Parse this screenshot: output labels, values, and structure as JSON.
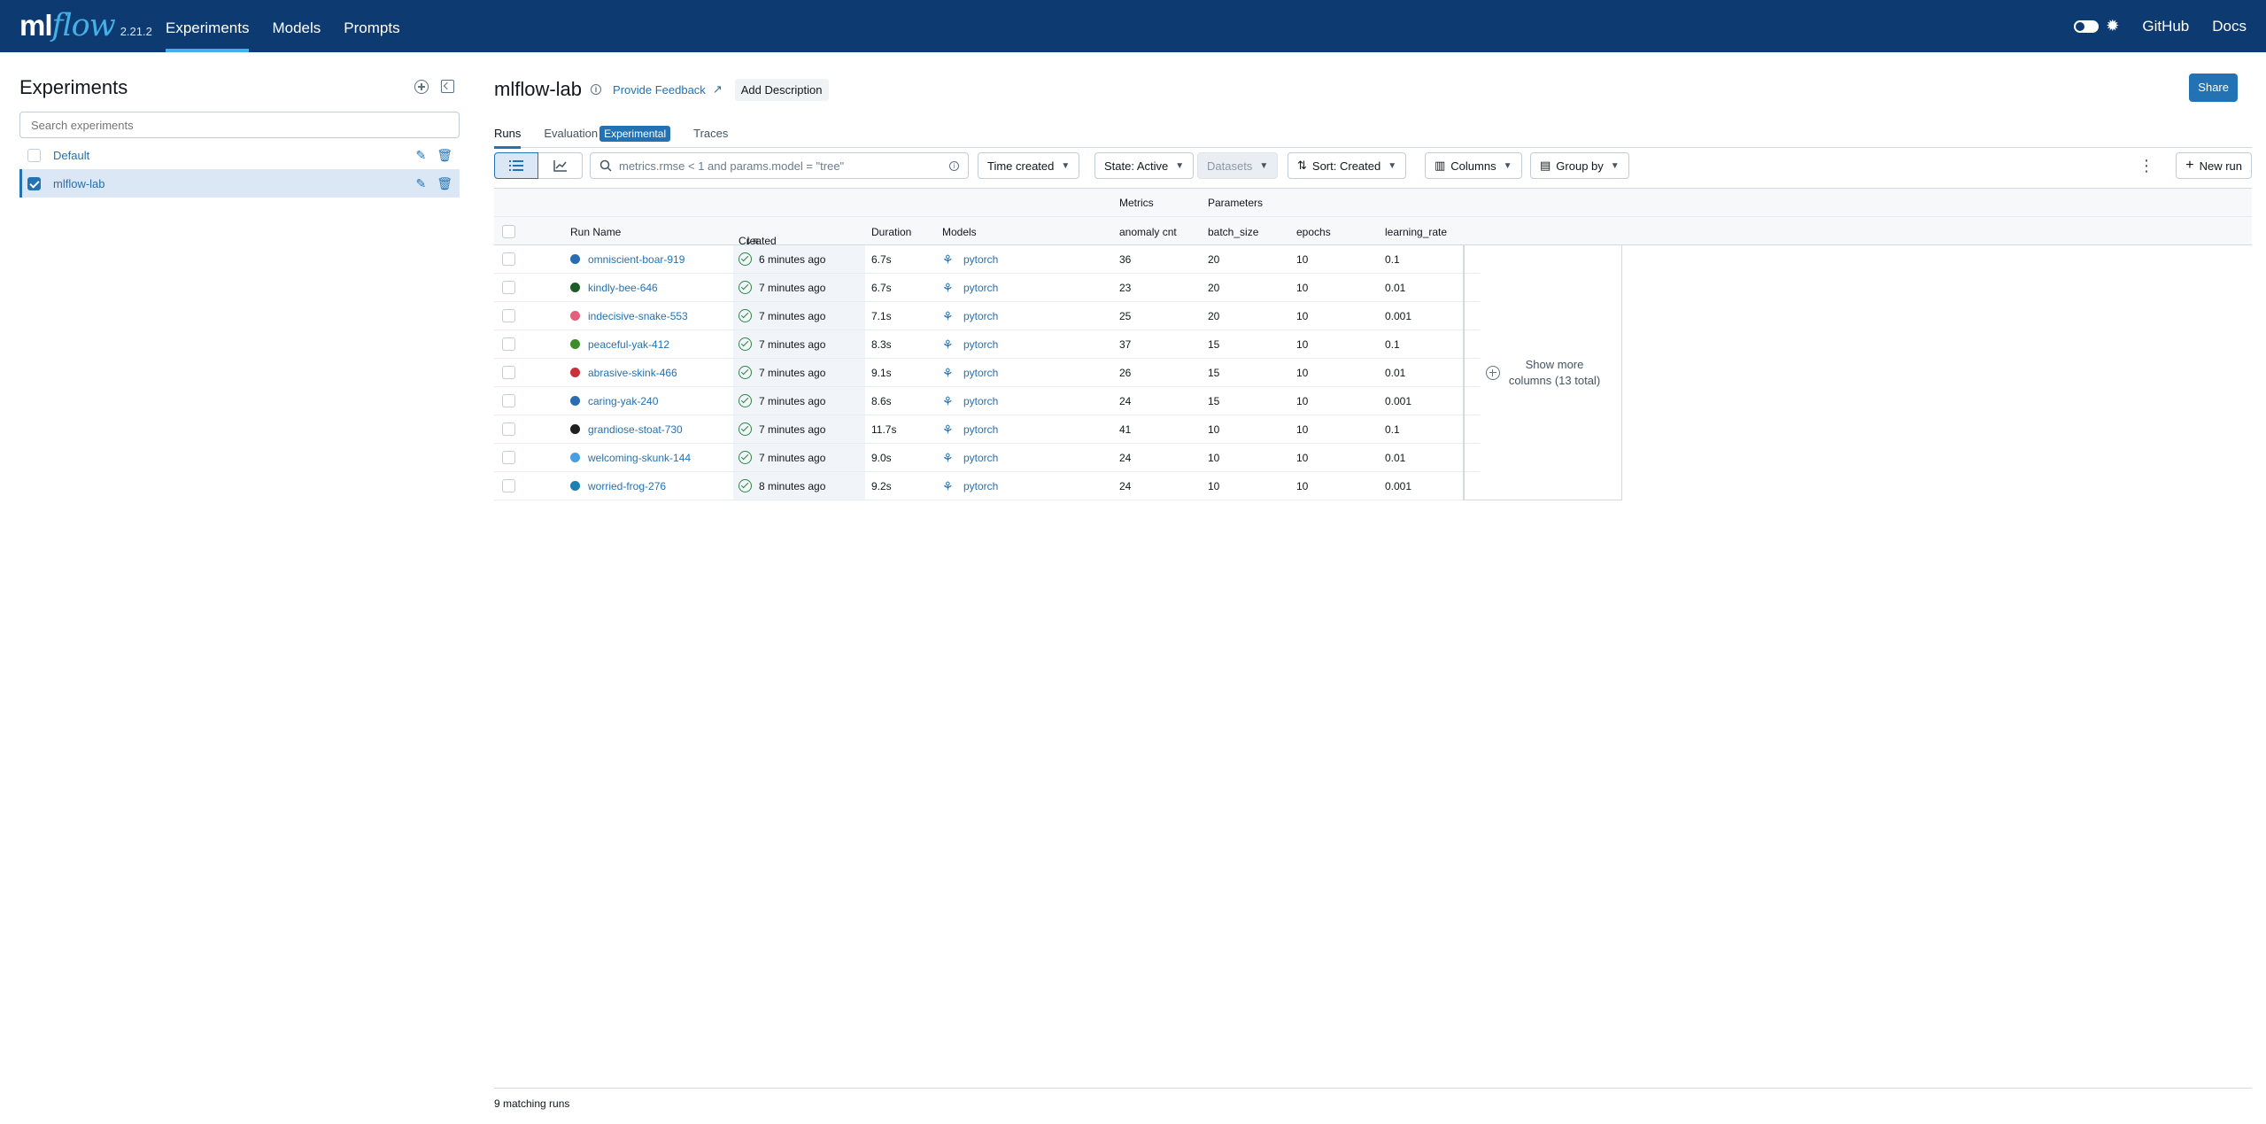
{
  "header": {
    "logo_ml": "ml",
    "logo_flow": "flow",
    "version": "2.21.2",
    "nav": [
      "Experiments",
      "Models",
      "Prompts"
    ],
    "github": "GitHub",
    "docs": "Docs"
  },
  "sidebar": {
    "title": "Experiments",
    "search_placeholder": "Search experiments",
    "items": [
      {
        "name": "Default",
        "checked": false
      },
      {
        "name": "mlflow-lab",
        "checked": true
      }
    ]
  },
  "main": {
    "title": "mlflow-lab",
    "feedback": "Provide Feedback",
    "add_description": "Add Description",
    "share": "Share",
    "tabs": {
      "runs": "Runs",
      "evaluation": "Evaluation",
      "experimental": "Experimental",
      "traces": "Traces"
    },
    "toolbar": {
      "search_placeholder": "metrics.rmse < 1 and params.model = \"tree\"",
      "time_created": "Time created",
      "state": "State: Active",
      "datasets": "Datasets",
      "sort": "Sort: Created",
      "columns": "Columns",
      "group_by": "Group by",
      "new_run": "New run"
    },
    "table": {
      "group_metrics": "Metrics",
      "group_params": "Parameters",
      "headers": {
        "run_name": "Run Name",
        "created": "Created",
        "duration": "Duration",
        "models": "Models",
        "anomaly": "anomaly cnt",
        "batch": "batch_size",
        "epochs": "epochs",
        "lr": "learning_rate"
      },
      "rows": [
        {
          "name": "omniscient-boar-919",
          "color": "#2a6cb0",
          "created": "6 minutes ago",
          "duration": "6.7s",
          "model": "pytorch",
          "anomaly": "36",
          "batch": "20",
          "epochs": "10",
          "lr": "0.1"
        },
        {
          "name": "kindly-bee-646",
          "color": "#1d5c2a",
          "created": "7 minutes ago",
          "duration": "6.7s",
          "model": "pytorch",
          "anomaly": "23",
          "batch": "20",
          "epochs": "10",
          "lr": "0.01"
        },
        {
          "name": "indecisive-snake-553",
          "color": "#e0607e",
          "created": "7 minutes ago",
          "duration": "7.1s",
          "model": "pytorch",
          "anomaly": "25",
          "batch": "20",
          "epochs": "10",
          "lr": "0.001"
        },
        {
          "name": "peaceful-yak-412",
          "color": "#3d8c2a",
          "created": "7 minutes ago",
          "duration": "8.3s",
          "model": "pytorch",
          "anomaly": "37",
          "batch": "15",
          "epochs": "10",
          "lr": "0.1"
        },
        {
          "name": "abrasive-skink-466",
          "color": "#c8303c",
          "created": "7 minutes ago",
          "duration": "9.1s",
          "model": "pytorch",
          "anomaly": "26",
          "batch": "15",
          "epochs": "10",
          "lr": "0.01"
        },
        {
          "name": "caring-yak-240",
          "color": "#2a6cb0",
          "created": "7 minutes ago",
          "duration": "8.6s",
          "model": "pytorch",
          "anomaly": "24",
          "batch": "15",
          "epochs": "10",
          "lr": "0.001"
        },
        {
          "name": "grandiose-stoat-730",
          "color": "#1f1f1f",
          "created": "7 minutes ago",
          "duration": "11.7s",
          "model": "pytorch",
          "anomaly": "41",
          "batch": "10",
          "epochs": "10",
          "lr": "0.1"
        },
        {
          "name": "welcoming-skunk-144",
          "color": "#4a9ee0",
          "created": "7 minutes ago",
          "duration": "9.0s",
          "model": "pytorch",
          "anomaly": "24",
          "batch": "10",
          "epochs": "10",
          "lr": "0.01"
        },
        {
          "name": "worried-frog-276",
          "color": "#1f7fb0",
          "created": "8 minutes ago",
          "duration": "9.2s",
          "model": "pytorch",
          "anomaly": "24",
          "batch": "10",
          "epochs": "10",
          "lr": "0.001"
        }
      ],
      "show_more_1": "Show more",
      "show_more_2": "columns (13 total)"
    },
    "footer": "9 matching runs"
  }
}
